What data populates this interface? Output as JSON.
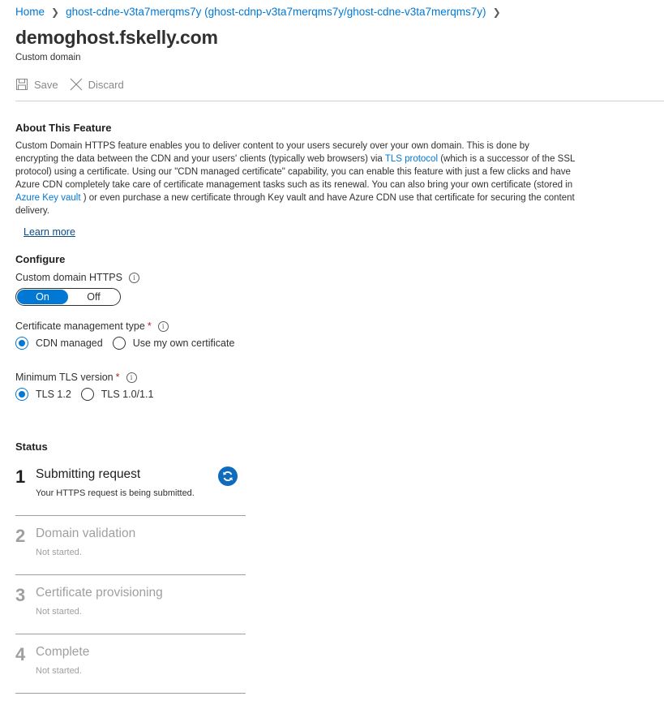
{
  "breadcrumb": {
    "home": "Home",
    "item": "ghost-cdne-v3ta7merqms7y (ghost-cdnp-v3ta7merqms7y/ghost-cdne-v3ta7merqms7y)",
    "separator": ">"
  },
  "page": {
    "title": "demoghost.fskelly.com",
    "subtitle": "Custom domain"
  },
  "toolbar": {
    "save_label": "Save",
    "discard_label": "Discard"
  },
  "about": {
    "heading": "About This Feature",
    "text_1": "Custom Domain HTTPS feature enables you to deliver content to your users securely over your own domain. This is done by encrypting the data between the CDN and your users' clients (typically web browsers) via ",
    "link_tls": "TLS protocol",
    "text_2": " (which is a successor of the SSL protocol) using a certificate. Using our \"CDN managed certificate\" capability, you can enable this feature with just a few clicks and have Azure CDN completely take care of certificate management tasks such as its renewal. You can also bring your own certificate (stored in ",
    "link_keyvault": "Azure Key vault",
    "text_3": " ) or even purchase a new certificate through Key vault and have Azure CDN use that certificate for securing the content delivery.",
    "learn_more": "Learn more"
  },
  "configure": {
    "heading": "Configure",
    "https_label": "Custom domain HTTPS",
    "toggle_on": "On",
    "toggle_off": "Off",
    "cert_type_label": "Certificate management type",
    "cert_required": "*",
    "cert_options": [
      "CDN managed",
      "Use my own certificate"
    ],
    "cert_selected": "CDN managed",
    "tls_label": "Minimum TLS version",
    "tls_required": "*",
    "tls_options": [
      "TLS 1.2",
      "TLS 1.0/1.1"
    ],
    "tls_selected": "TLS 1.2",
    "info_glyph": "i"
  },
  "status": {
    "heading": "Status",
    "steps": [
      {
        "num": "1",
        "title": "Submitting request",
        "desc": "Your HTTPS request is being submitted.",
        "state": "active"
      },
      {
        "num": "2",
        "title": "Domain validation",
        "desc": "Not started.",
        "state": "inactive"
      },
      {
        "num": "3",
        "title": "Certificate provisioning",
        "desc": "Not started.",
        "state": "inactive"
      },
      {
        "num": "4",
        "title": "Complete",
        "desc": "Not started.",
        "state": "inactive"
      }
    ]
  },
  "colors": {
    "accent": "#0078d4",
    "required": "#a4262c",
    "muted": "#a19f9d"
  }
}
